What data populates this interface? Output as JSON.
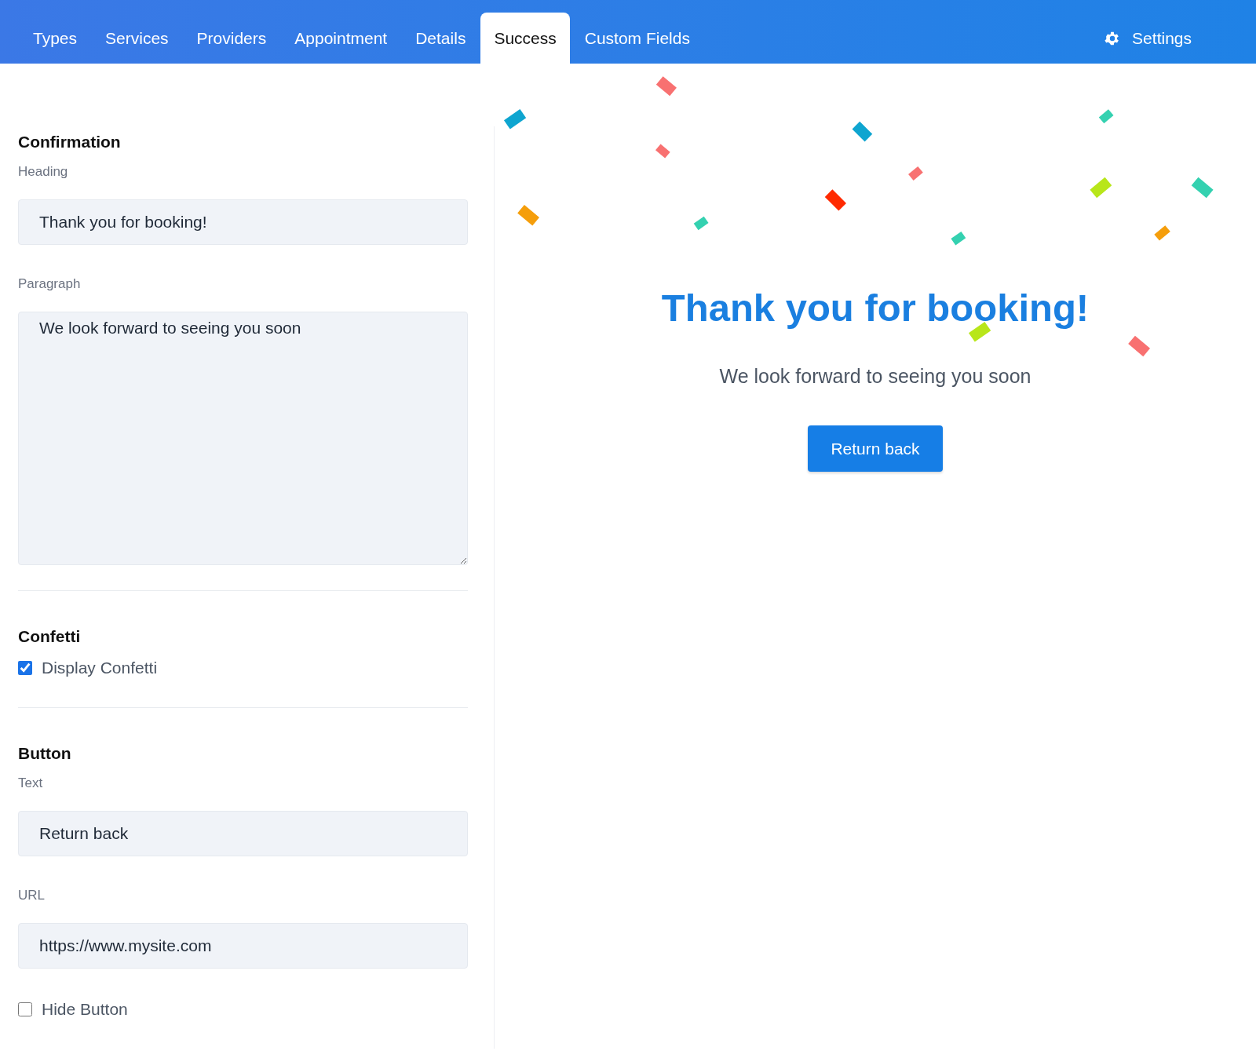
{
  "tabs": [
    {
      "label": "Types",
      "selected": false
    },
    {
      "label": "Services",
      "selected": false
    },
    {
      "label": "Providers",
      "selected": false
    },
    {
      "label": "Appointment",
      "selected": false
    },
    {
      "label": "Details",
      "selected": false
    },
    {
      "label": "Success",
      "selected": true
    },
    {
      "label": "Custom Fields",
      "selected": false
    }
  ],
  "settings": {
    "label": "Settings"
  },
  "form": {
    "confirmation": {
      "title": "Confirmation",
      "heading_label": "Heading",
      "heading_value": "Thank you for booking!",
      "paragraph_label": "Paragraph",
      "paragraph_value": "We look forward to seeing you soon"
    },
    "confetti": {
      "title": "Confetti",
      "display_label": "Display Confetti",
      "checked": true
    },
    "button": {
      "title": "Button",
      "text_label": "Text",
      "text_value": "Return back",
      "url_label": "URL",
      "url_value": "https://www.mysite.com",
      "hide_label": "Hide Button",
      "checked": false
    }
  },
  "preview": {
    "heading": "Thank you for booking!",
    "paragraph": "We look forward to seeing you soon",
    "button": "Return back"
  }
}
